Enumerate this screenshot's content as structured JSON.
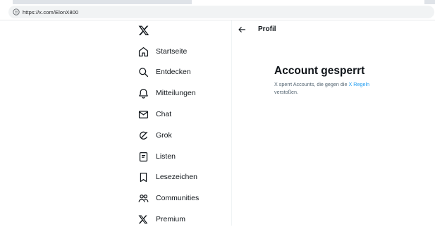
{
  "browser": {
    "url": "https://x.com/ElonX800"
  },
  "nav": {
    "items": [
      {
        "label": "Startseite",
        "icon": "home-icon"
      },
      {
        "label": "Entdecken",
        "icon": "search-icon"
      },
      {
        "label": "Mitteilungen",
        "icon": "bell-icon"
      },
      {
        "label": "Chat",
        "icon": "envelope-icon"
      },
      {
        "label": "Grok",
        "icon": "grok-icon"
      },
      {
        "label": "Listen",
        "icon": "list-icon"
      },
      {
        "label": "Lesezeichen",
        "icon": "bookmark-icon"
      },
      {
        "label": "Communities",
        "icon": "people-icon"
      },
      {
        "label": "Premium",
        "icon": "x-logo-icon"
      }
    ]
  },
  "main": {
    "header_title": "Profil",
    "suspended": {
      "title": "Account gesperrt",
      "text_before": "X sperrt Accounts, die gegen die ",
      "link": "X Regeln",
      "text_after": " verstoßen."
    }
  },
  "colors": {
    "text": "#0f1419",
    "secondary_text": "#536471",
    "link": "#1d9bf0"
  }
}
